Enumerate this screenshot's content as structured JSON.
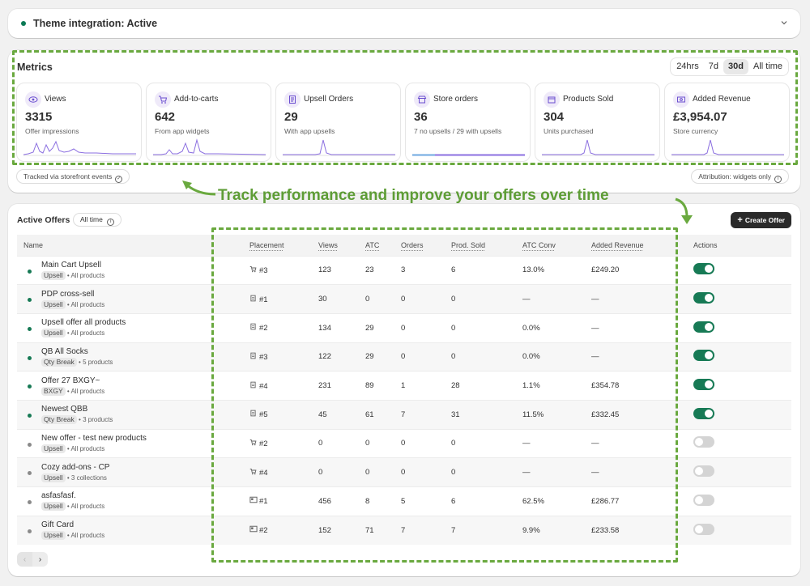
{
  "theme": {
    "title": "Theme integration: Active",
    "status_color": "#0a7a55"
  },
  "metrics": {
    "title": "Metrics",
    "ranges": [
      {
        "label": "24hrs",
        "active": false
      },
      {
        "label": "7d",
        "active": false
      },
      {
        "label": "30d",
        "active": true
      },
      {
        "label": "All time",
        "active": false
      }
    ],
    "cards": [
      {
        "label": "Views",
        "value": "3315",
        "sub": "Offer impressions",
        "icon": "eye-icon"
      },
      {
        "label": "Add-to-carts",
        "value": "642",
        "sub": "From app widgets",
        "icon": "cart-icon"
      },
      {
        "label": "Upsell Orders",
        "value": "29",
        "sub": "With app upsells",
        "icon": "receipt-icon"
      },
      {
        "label": "Store orders",
        "value": "36",
        "sub": "7 no upsells / 29 with upsells",
        "icon": "store-icon"
      },
      {
        "label": "Products Sold",
        "value": "304",
        "sub": "Units purchased",
        "icon": "box-icon"
      },
      {
        "label": "Added Revenue",
        "value": "£3,954.07",
        "sub": "Store currency",
        "icon": "cash-icon"
      }
    ],
    "tracked_label": "Tracked via storefront events",
    "attribution_label": "Attribution: widgets only",
    "accent_color": "#8b6fe0"
  },
  "annotation": {
    "text": "Track performance and improve your offers over time",
    "color": "#6aa93f"
  },
  "offers": {
    "title": "Active Offers",
    "range_label": "All time",
    "create_label": "Create Offer",
    "columns": {
      "name": "Name",
      "placement": "Placement",
      "views": "Views",
      "atc": "ATC",
      "orders": "Orders",
      "sold": "Prod. Sold",
      "conv": "ATC Conv",
      "revenue": "Added Revenue",
      "actions": "Actions"
    },
    "rows": [
      {
        "name": "Main Cart Upsell",
        "tag": "Upsell",
        "scope": "All products",
        "placement": "#3",
        "pl_icon": "cart-icon",
        "views": "123",
        "atc": "23",
        "orders": "3",
        "sold": "6",
        "conv": "13.0%",
        "revenue": "£249.20",
        "active": true
      },
      {
        "name": "PDP cross-sell",
        "tag": "Upsell",
        "scope": "All products",
        "placement": "#1",
        "pl_icon": "page-icon",
        "views": "30",
        "atc": "0",
        "orders": "0",
        "sold": "0",
        "conv": "—",
        "revenue": "—",
        "active": true
      },
      {
        "name": "Upsell offer all products",
        "tag": "Upsell",
        "scope": "All products",
        "placement": "#2",
        "pl_icon": "page-icon",
        "views": "134",
        "atc": "29",
        "orders": "0",
        "sold": "0",
        "conv": "0.0%",
        "revenue": "—",
        "active": true
      },
      {
        "name": "QB All Socks",
        "tag": "Qty Break",
        "scope": "5 products",
        "placement": "#3",
        "pl_icon": "page-icon",
        "views": "122",
        "atc": "29",
        "orders": "0",
        "sold": "0",
        "conv": "0.0%",
        "revenue": "—",
        "active": true
      },
      {
        "name": "Offer 27 BXGY~",
        "tag": "BXGY",
        "scope": "All products",
        "placement": "#4",
        "pl_icon": "page-icon",
        "views": "231",
        "atc": "89",
        "orders": "1",
        "sold": "28",
        "conv": "1.1%",
        "revenue": "£354.78",
        "active": true
      },
      {
        "name": "Newest QBB",
        "tag": "Qty Break",
        "scope": "3 products",
        "placement": "#5",
        "pl_icon": "page-icon",
        "views": "45",
        "atc": "61",
        "orders": "7",
        "sold": "31",
        "conv": "11.5%",
        "revenue": "£332.45",
        "active": true
      },
      {
        "name": "New offer - test new products",
        "tag": "Upsell",
        "scope": "All products",
        "placement": "#2",
        "pl_icon": "cart-icon",
        "views": "0",
        "atc": "0",
        "orders": "0",
        "sold": "0",
        "conv": "—",
        "revenue": "—",
        "active": false
      },
      {
        "name": "Cozy add-ons - CP",
        "tag": "Upsell",
        "scope": "3 collections",
        "placement": "#4",
        "pl_icon": "cart-icon",
        "views": "0",
        "atc": "0",
        "orders": "0",
        "sold": "0",
        "conv": "—",
        "revenue": "—",
        "active": false
      },
      {
        "name": "asfasfasf.",
        "tag": "Upsell",
        "scope": "All products",
        "placement": "#1",
        "pl_icon": "card-icon",
        "views": "456",
        "atc": "8",
        "orders": "5",
        "sold": "6",
        "conv": "62.5%",
        "revenue": "£286.77",
        "active": false
      },
      {
        "name": "Gift Card",
        "tag": "Upsell",
        "scope": "All products",
        "placement": "#2",
        "pl_icon": "card-icon",
        "views": "152",
        "atc": "71",
        "orders": "7",
        "sold": "7",
        "conv": "9.9%",
        "revenue": "£233.58",
        "active": false
      }
    ],
    "active_color": "#177a55",
    "inactive_color": "#8a8a8a"
  }
}
